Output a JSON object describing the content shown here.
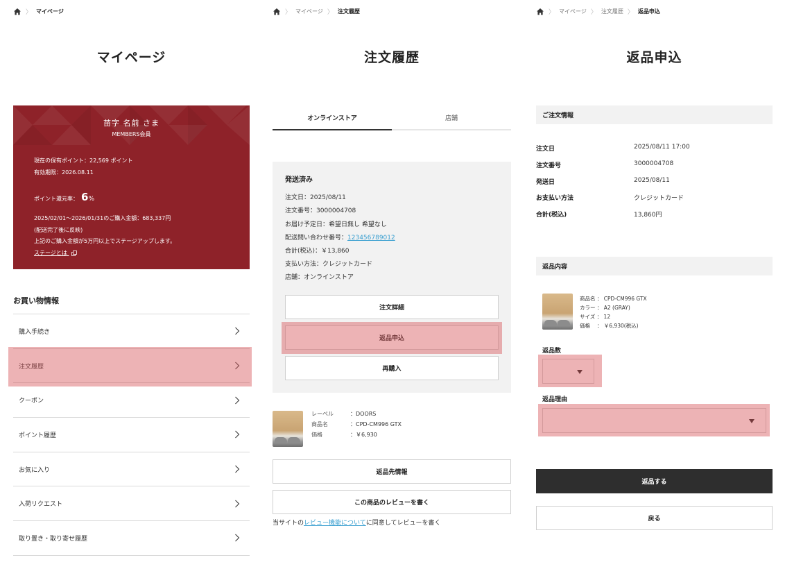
{
  "breadcrumbs": {
    "p1": [
      "マイページ"
    ],
    "p2": [
      "マイページ",
      "注文履歴"
    ],
    "p3": [
      "マイページ",
      "注文履歴",
      "返品申込"
    ]
  },
  "mypage": {
    "title": "マイページ",
    "member": {
      "name": "苗字 名前 さま",
      "rank": "MEMBERS会員",
      "points": "現在の保有ポイント：22,569 ポイント",
      "expiry": "有効期限：2026.08.11",
      "rate_label": "ポイント還元率：",
      "rate_value": "6",
      "rate_unit": "%",
      "period": "2025/02/01～2026/01/31のご購入金額：683,337円",
      "period_note": "(配送完了後に反映)",
      "stage_note": "上記のご購入金額が5万円以上でステージアップします。",
      "stage_link": "ステージとは"
    },
    "section_title": "お買い物情報",
    "menu": [
      {
        "label": "購入手続き"
      },
      {
        "label": "注文履歴"
      },
      {
        "label": "クーポン"
      },
      {
        "label": "ポイント履歴"
      },
      {
        "label": "お気に入り"
      },
      {
        "label": "入荷リクエスト"
      },
      {
        "label": "取り置き・取り寄せ履歴"
      }
    ]
  },
  "history": {
    "title": "注文履歴",
    "tabs": [
      "オンラインストア",
      "店舗"
    ],
    "order": {
      "status": "発送済み",
      "order_date": "注文日：2025/08/11",
      "order_no": "注文番号：3000004708",
      "delivery": "お届け予定日：希望日無し 希望なし",
      "tracking_label": "配送問い合わせ番号：",
      "tracking_no": "123456789012",
      "total": "合計(税込)：￥13,860",
      "payment": "支払い方法：クレジットカード",
      "store": "店舗：オンラインストア"
    },
    "buttons": {
      "detail": "注文詳細",
      "return": "返品申込",
      "rebuy": "再購入",
      "return_info": "返品先情報",
      "review": "この商品のレビューを書く"
    },
    "product": {
      "label_key": "レーベル",
      "label_val": "：DOORS",
      "name_key": "商品名",
      "name_val": "：CPD-CM996 GTX",
      "price_key": "価格",
      "price_val": "：￥6,930"
    },
    "note_pre": "当サイトの",
    "note_link": "レビュー機能について",
    "note_post": "に同意してレビューを書く"
  },
  "returns": {
    "title": "返品申込",
    "order_section": "ご注文情報",
    "order_rows": [
      {
        "k": "注文日",
        "v": "2025/08/11 17:00"
      },
      {
        "k": "注文番号",
        "v": "3000004708"
      },
      {
        "k": "発送日",
        "v": "2025/08/11"
      },
      {
        "k": "お支払い方法",
        "v": "クレジットカード"
      },
      {
        "k": "合計(税込)",
        "v": "13,860円"
      }
    ],
    "return_section": "返品内容",
    "product": {
      "name": "商品名 ： CPD-CM996 GTX",
      "color": "カラー ： A2 (GRAY)",
      "size": "サイズ ： 12",
      "price": "価格　 ： ￥6,930(税込)"
    },
    "qty_label": "返品数",
    "reason_label": "返品理由",
    "submit": "返品する",
    "back": "戻る"
  },
  "colors": {
    "brand": "#8e2229",
    "highlight": "#d6565a",
    "link": "#3a9fd0",
    "dark_button": "#2e2e2e"
  }
}
